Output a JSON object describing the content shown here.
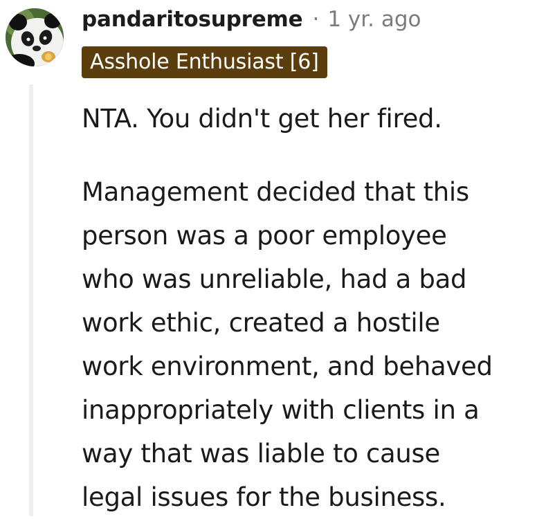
{
  "comment": {
    "avatar_icon": "panda-avatar-icon",
    "username": "pandaritosupreme",
    "separator": "·",
    "timestamp": "1 yr. ago",
    "flair": {
      "text": "Asshole Enthusiast [6]",
      "background": "#5c3d0e",
      "color": "#ffffff"
    },
    "paragraphs": [
      {
        "lines": [
          "NTA. You didn't get her fired."
        ]
      },
      {
        "lines": [
          "Management decided that this",
          "person was a poor employee",
          "who was unreliable, had a bad",
          "work ethic, created a hostile",
          "work environment, and behaved",
          "inappropriately with clients in a",
          "way that was liable to cause",
          "legal issues for the business."
        ]
      }
    ]
  }
}
